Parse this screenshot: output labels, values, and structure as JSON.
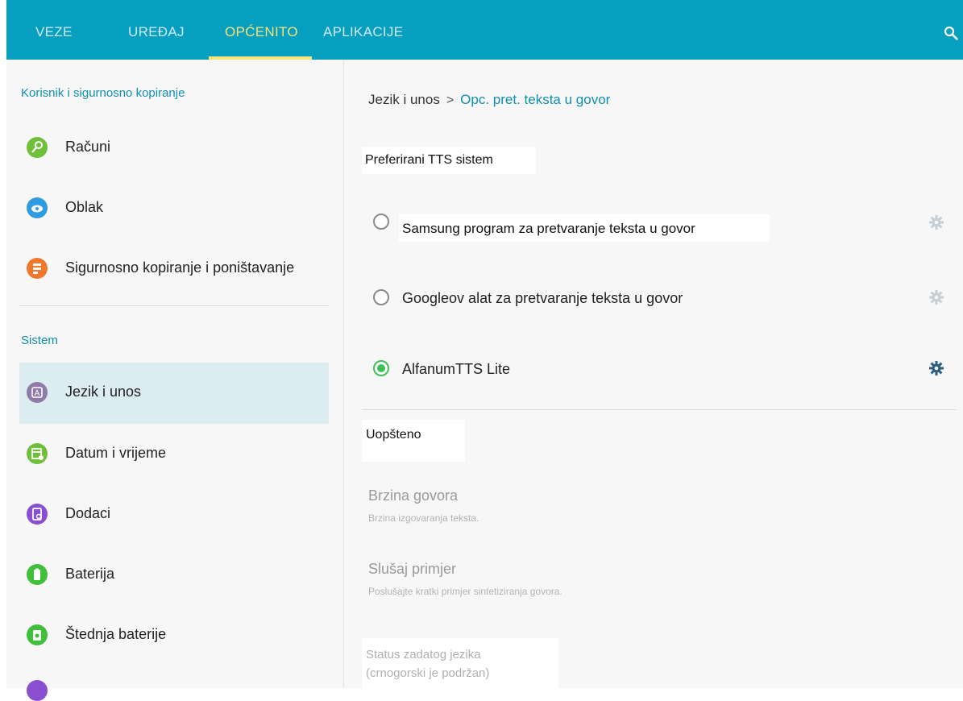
{
  "tabs": [
    {
      "label": "VEZE"
    },
    {
      "label": "UREĐAJ"
    },
    {
      "label": "OPĆENITO"
    },
    {
      "label": "APLIKACIJE"
    }
  ],
  "active_tab": "OPĆENITO",
  "colors": {
    "topbar": "#079fc0",
    "active_tab": "#f6e37a",
    "accent": "#118fb0",
    "radio_selected": "#3fbf57"
  },
  "sidebar": {
    "section1_title": "Korisnik i sigurnosno kopiranje",
    "section1_items": [
      {
        "label": "Računi",
        "icon": "key-icon",
        "color": "#6fbf3a"
      },
      {
        "label": "Oblak",
        "icon": "cloud-icon",
        "color": "#2f9be0"
      },
      {
        "label": "Sigurnosno kopiranje i poništavanje",
        "icon": "backup-icon",
        "color": "#f0782c"
      }
    ],
    "section2_title": "Sistem",
    "section2_items": [
      {
        "label": "Jezik i unos",
        "icon": "language-icon",
        "color": "#8f7aa8",
        "selected": true
      },
      {
        "label": "Datum i vrijeme",
        "icon": "calendar-icon",
        "color": "#6fbf3a"
      },
      {
        "label": "Dodaci",
        "icon": "accessories-icon",
        "color": "#8a4fd0"
      },
      {
        "label": "Baterija",
        "icon": "battery-icon",
        "color": "#3fbf3a"
      },
      {
        "label": "Štednja baterije",
        "icon": "power-saving-icon",
        "color": "#3fbf3a"
      }
    ]
  },
  "breadcrumb": {
    "parent": "Jezik i unos",
    "separator": ">",
    "current": "Opc. pret. teksta u govor"
  },
  "tts": {
    "title": "Preferirani TTS sistem",
    "options": [
      {
        "label": "Samsung program za pretvaranje teksta u govor",
        "selected": false
      },
      {
        "label": "Googleov alat za pretvaranje teksta u govor",
        "selected": false
      },
      {
        "label": "AlfanumTTS Lite",
        "selected": true
      }
    ]
  },
  "general": {
    "title": "Uopšteno",
    "speech_rate_title": "Brzina govora",
    "speech_rate_sub": "Brzina izgovaranja teksta.",
    "sample_title": "Slušaj primjer",
    "sample_sub": "Poslušajte kratki primjer sintetiziranja govora.",
    "status_line1": "Status zadatog jezika",
    "status_line2": "(crnogorski je podržan)"
  }
}
